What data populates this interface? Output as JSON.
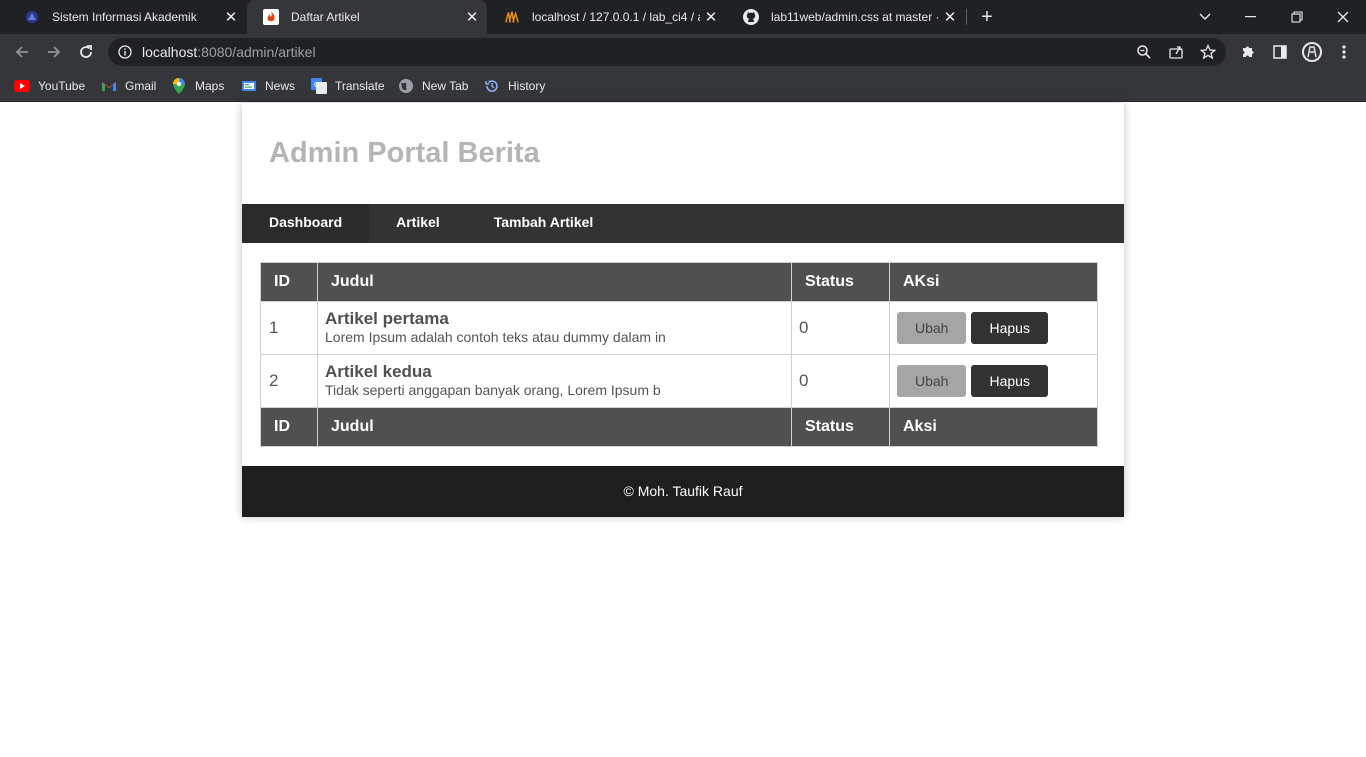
{
  "browser": {
    "tabs": [
      {
        "title": "Sistem Informasi Akademik",
        "icon": "university-logo-icon",
        "active": false
      },
      {
        "title": "Daftar Artikel",
        "icon": "codeigniter-flame-icon",
        "active": true
      },
      {
        "title": "localhost / 127.0.0.1 / lab_ci4 / ar",
        "icon": "phpmyadmin-icon",
        "active": false
      },
      {
        "title": "lab11web/admin.css at master · b",
        "icon": "github-icon",
        "active": false
      }
    ],
    "url_host": "localhost",
    "url_rest": ":8080/admin/artikel",
    "bookmarks": [
      {
        "label": "YouTube",
        "icon": "youtube-icon"
      },
      {
        "label": "Gmail",
        "icon": "gmail-icon"
      },
      {
        "label": "Maps",
        "icon": "maps-icon"
      },
      {
        "label": "News",
        "icon": "news-icon"
      },
      {
        "label": "Translate",
        "icon": "translate-icon"
      },
      {
        "label": "New Tab",
        "icon": "globe-icon"
      },
      {
        "label": "History",
        "icon": "history-icon"
      }
    ]
  },
  "page": {
    "title": "Admin Portal Berita",
    "nav": [
      {
        "label": "Dashboard"
      },
      {
        "label": "Artikel"
      },
      {
        "label": "Tambah Artikel"
      }
    ],
    "table": {
      "head": {
        "id": "ID",
        "judul": "Judul",
        "status": "Status",
        "aksi": "AKsi"
      },
      "rows": [
        {
          "id": "1",
          "title": "Artikel pertama",
          "desc": "Lorem Ipsum adalah contoh teks atau dummy dalam in",
          "status": "0",
          "edit": "Ubah",
          "delete": "Hapus"
        },
        {
          "id": "2",
          "title": "Artikel kedua",
          "desc": "Tidak seperti anggapan banyak orang, Lorem Ipsum b",
          "status": "0",
          "edit": "Ubah",
          "delete": "Hapus"
        }
      ],
      "foot": {
        "id": "ID",
        "judul": "Judul",
        "status": "Status",
        "aksi": "Aksi"
      }
    },
    "footer": "© Moh. Taufik Rauf"
  },
  "colors": {
    "nav_bg": "#333333",
    "table_head_bg": "#505050",
    "footer_bg": "#1e1e1e",
    "title_color": "#b5b5b5",
    "btn_edit": "#a5a5a5",
    "btn_delete": "#333333"
  }
}
